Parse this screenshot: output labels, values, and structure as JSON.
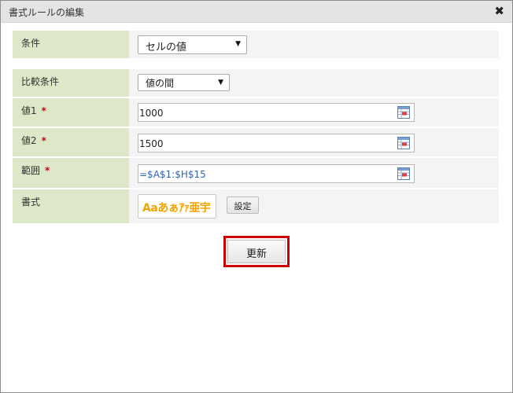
{
  "dialog": {
    "title": "書式ルールの編集",
    "close_symbol": "✖"
  },
  "condition": {
    "label": "条件",
    "selected": "セルの値"
  },
  "comparison": {
    "label": "比較条件",
    "selected": "値の間"
  },
  "value1": {
    "label": "値1",
    "required_mark": "*",
    "value": "1000"
  },
  "value2": {
    "label": "値2",
    "required_mark": "*",
    "value": "1500"
  },
  "range": {
    "label": "範囲",
    "required_mark": "*",
    "value": "=$A$1:$H$15"
  },
  "format": {
    "label": "書式",
    "preview_text": "Aaあぁｱｧ亜宇",
    "settings_button": "設定"
  },
  "update_button": "更新",
  "icons": {
    "close": "close-icon",
    "range_picker": "range-picker-icon",
    "caret": "chevron-down-icon"
  },
  "colors": {
    "label_background": "#dce8c7",
    "highlight_outline": "#cc0000",
    "required_mark": "#d0021b",
    "preview_text": "#f2a300"
  }
}
